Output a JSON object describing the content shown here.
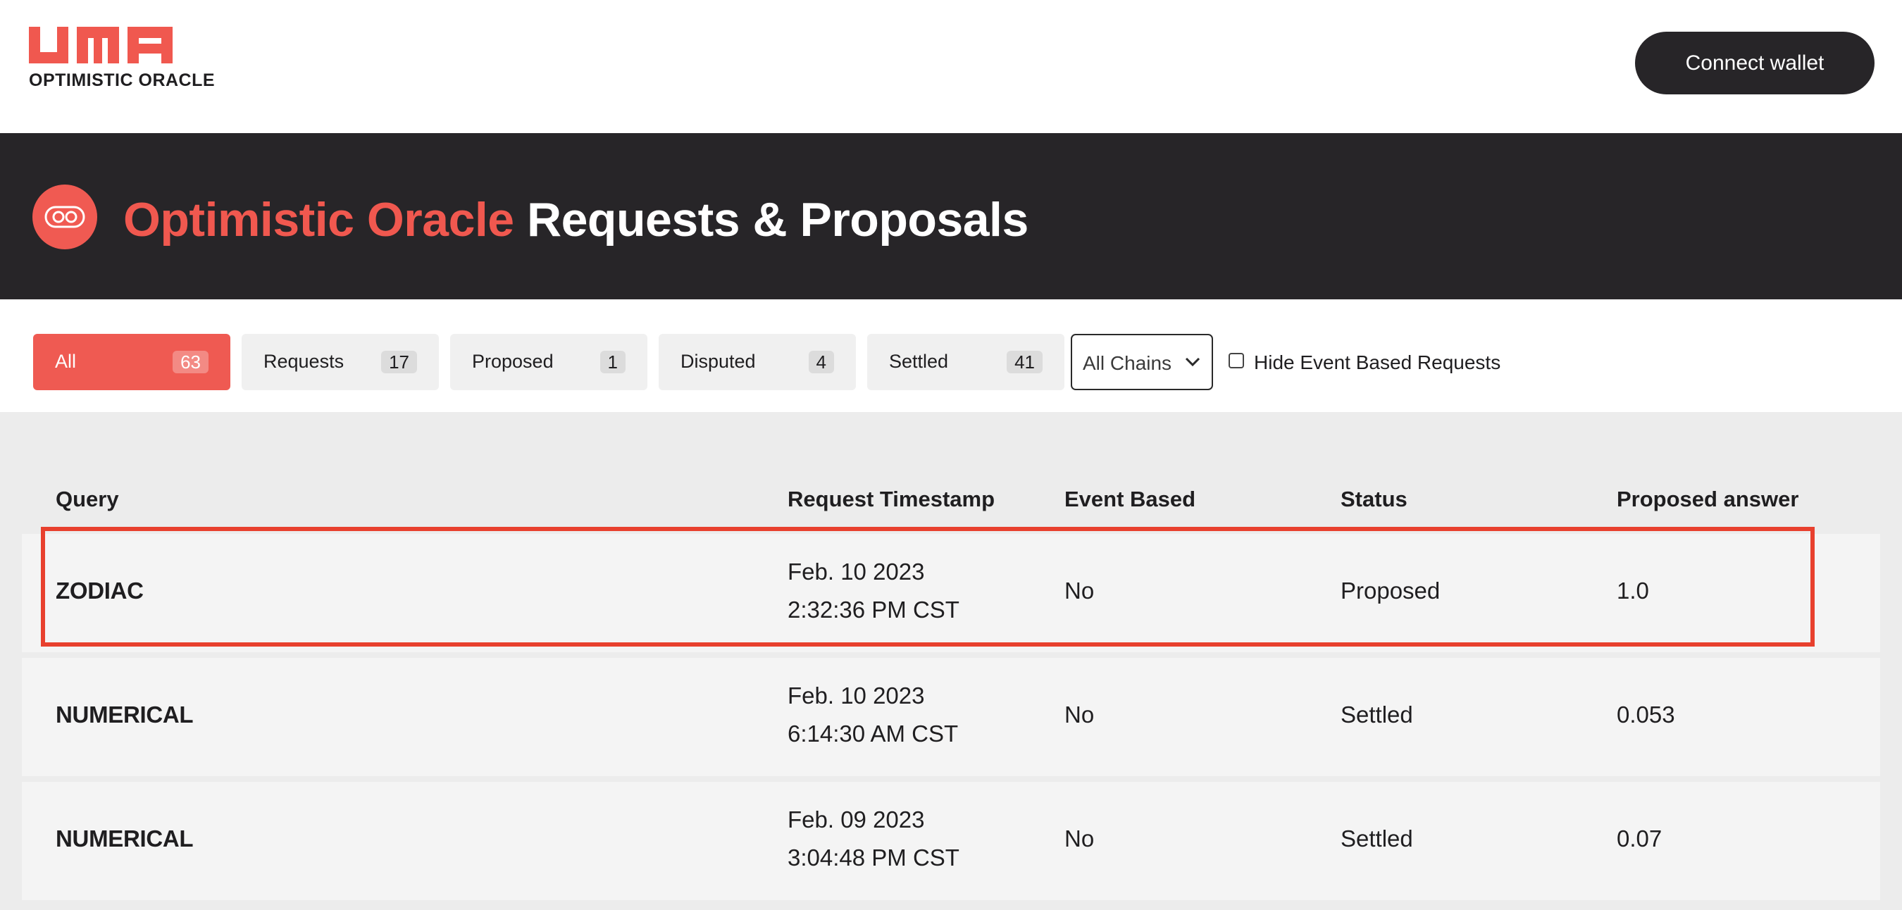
{
  "header": {
    "logo_text": "UMA",
    "logo_subtitle": "OPTIMISTIC ORACLE",
    "connect_label": "Connect wallet",
    "brand_color": "#f0584f"
  },
  "hero": {
    "title_accent": "Optimistic Oracle",
    "title_main": "Requests & Proposals",
    "icon": "oracle-eyes-icon"
  },
  "filters": {
    "tabs": [
      {
        "label": "All",
        "count": "63",
        "active": true
      },
      {
        "label": "Requests",
        "count": "17"
      },
      {
        "label": "Proposed",
        "count": "1"
      },
      {
        "label": "Disputed",
        "count": "4"
      },
      {
        "label": "Settled",
        "count": "41"
      }
    ],
    "chain_select": "All Chains",
    "hide_event_label": "Hide Event Based Requests",
    "hide_event_checked": false
  },
  "table": {
    "columns": [
      "Query",
      "Request Timestamp",
      "Event Based",
      "Status",
      "Proposed answer"
    ],
    "rows": [
      {
        "query": "ZODIAC",
        "date": "Feb. 10 2023",
        "time": "2:32:36 PM CST",
        "event_based": "No",
        "status": "Proposed",
        "answer": "1.0"
      },
      {
        "query": "NUMERICAL",
        "date": "Feb. 10 2023",
        "time": "6:14:30 AM CST",
        "event_based": "No",
        "status": "Settled",
        "answer": "0.053"
      },
      {
        "query": "NUMERICAL",
        "date": "Feb. 09 2023",
        "time": "3:04:48 PM CST",
        "event_based": "No",
        "status": "Settled",
        "answer": "0.07"
      }
    ]
  }
}
